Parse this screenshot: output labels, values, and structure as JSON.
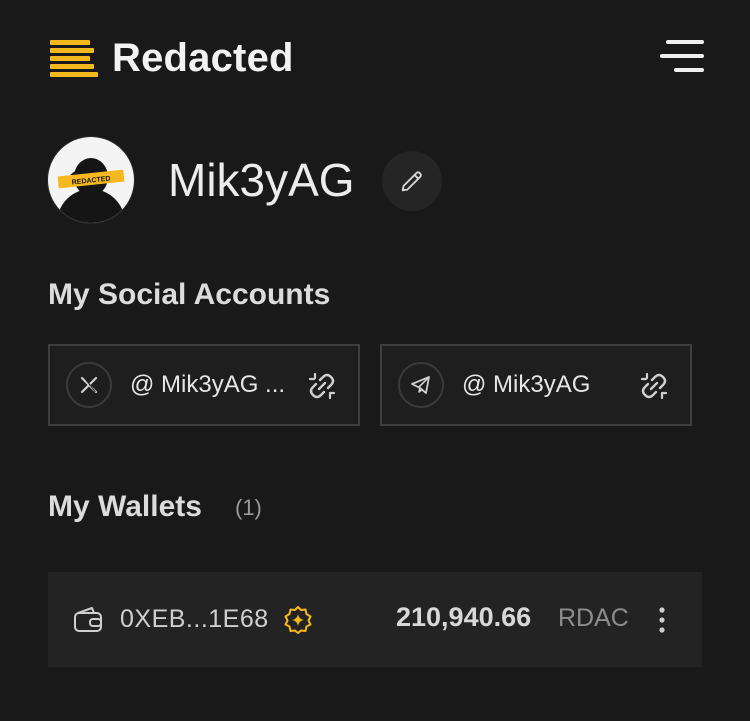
{
  "header": {
    "brand": "Redacted",
    "brand_color": "#f5b91f",
    "menu_icon": "menu-icon"
  },
  "profile": {
    "avatar_label": "REDACTED",
    "username": "Mik3yAG",
    "edit_icon": "pencil-icon"
  },
  "social": {
    "title": "My Social Accounts",
    "accounts": [
      {
        "platform": "x-icon",
        "handle": "@ Mik3yAG ...",
        "action_icon": "relink-icon"
      },
      {
        "platform": "telegram-icon",
        "handle": "@ Mik3yAG",
        "action_icon": "relink-icon"
      }
    ]
  },
  "wallets": {
    "title": "My Wallets",
    "count": "(1)",
    "items": [
      {
        "address": "0XEB...1E68",
        "badge_icon": "verified-sparkle-icon",
        "badge_color": "#f5b91f",
        "balance": "210,940.66",
        "ticker": "RDAC",
        "more_icon": "more-vertical-icon"
      }
    ]
  }
}
